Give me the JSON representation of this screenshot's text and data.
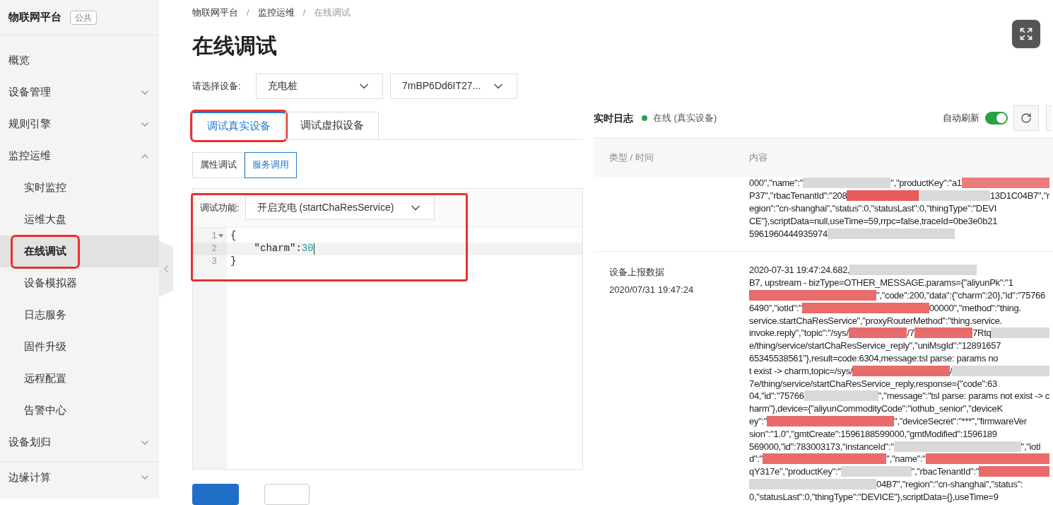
{
  "sidebar": {
    "title": "物联网平台",
    "badge": "公共",
    "items": [
      {
        "label": "概览"
      },
      {
        "label": "设备管理",
        "expanded": false
      },
      {
        "label": "规则引擎",
        "expanded": false
      },
      {
        "label": "监控运维",
        "expanded": true,
        "children": [
          {
            "label": "实时监控",
            "selected": false,
            "annotated": false
          },
          {
            "label": "运维大盘",
            "selected": false,
            "annotated": false
          },
          {
            "label": "在线调试",
            "selected": true,
            "annotated": true
          },
          {
            "label": "设备模拟器",
            "selected": false,
            "annotated": false
          },
          {
            "label": "日志服务",
            "selected": false,
            "annotated": false
          },
          {
            "label": "固件升级",
            "selected": false,
            "annotated": false
          },
          {
            "label": "远程配置",
            "selected": false,
            "annotated": false
          },
          {
            "label": "告警中心",
            "selected": false,
            "annotated": false
          }
        ]
      },
      {
        "label": "设备划归",
        "expanded": false
      },
      {
        "label": "边缘计算",
        "expanded": false
      }
    ]
  },
  "breadcrumb": [
    "物联网平台",
    "监控运维",
    "在线调试"
  ],
  "breadcrumb_separator": "/",
  "page_title": "在线调试",
  "device_select": {
    "label": "请选择设备:",
    "product": "充电桩",
    "device": "7mBP6Dd6IT27..."
  },
  "tabs": [
    {
      "label": "调试真实设备",
      "selected": true,
      "annotated": true
    },
    {
      "label": "调试虚拟设备",
      "selected": false,
      "annotated": false
    }
  ],
  "subtabs": [
    {
      "label": "属性调试",
      "selected": false
    },
    {
      "label": "服务调用",
      "selected": true
    }
  ],
  "function_panel": {
    "annotated": true,
    "label": "调试功能:",
    "value": "开启充电 (startChaResService)",
    "code_lines": [
      {
        "number": "1",
        "foldable": true,
        "active": false,
        "tokens": [
          {
            "kind": "punct",
            "text": "{"
          }
        ]
      },
      {
        "number": "2",
        "foldable": false,
        "active": true,
        "tokens": [
          {
            "kind": "punct",
            "text": "    \"charm\":"
          },
          {
            "kind": "number",
            "text": "30"
          }
        ]
      },
      {
        "number": "3",
        "foldable": false,
        "active": false,
        "tokens": [
          {
            "kind": "punct",
            "text": "}"
          }
        ]
      }
    ]
  },
  "log": {
    "title": "实时日志",
    "status": {
      "text": "在线 (真实设备)",
      "color": "#2e9e4f"
    },
    "auto_refresh": {
      "label": "自动刷新",
      "on": true
    },
    "columns": [
      "类型 / 时间",
      "内容"
    ],
    "records": [
      {
        "lines": [
          [
            {
              "kind": "text",
              "text": "000\",\"name\":\""
            },
            {
              "kind": "redacted",
              "color": "#d9d9d9"
            },
            {
              "kind": "text",
              "text": "\",\"productKey\":\"a1"
            },
            {
              "kind": "redacted",
              "color": "#ec7b7b"
            }
          ],
          [
            {
              "kind": "text",
              "text": "P37\",\"rbacTenantId\":\"208"
            },
            {
              "kind": "redacted",
              "color": "#e85a5a"
            },
            {
              "kind": "redacted",
              "color": "#d9d9d9"
            },
            {
              "kind": "text",
              "text": "13D1C04B7\",\"r"
            }
          ],
          [
            {
              "kind": "text",
              "text": "egion\":\"cn-shanghai\",\"status\":0,\"statusLast\":0,\"thingType\":\"DEVI"
            }
          ],
          [
            {
              "kind": "text",
              "text": "CE\"},scriptData=null,useTime=59,rrpc=false,traceId=0be3e0b21"
            }
          ],
          [
            {
              "kind": "text",
              "text": "5961960444935974"
            },
            {
              "kind": "redacted",
              "color": "#d9d9d9"
            }
          ]
        ]
      },
      {
        "type": "设备上报数据",
        "time": "2020/07/31 19:47:24",
        "lines": [
          [
            {
              "kind": "text",
              "text": "2020-07-31 19:47:24.682, "
            },
            {
              "kind": "redacted",
              "color": "#d9d9d9"
            }
          ],
          [
            {
              "kind": "text",
              "text": "B7, upstream - bizType=OTHER_MESSAGE,params={\"aliyunPk\":\"1"
            }
          ],
          [
            {
              "kind": "redacted",
              "color": "#e96b6b"
            },
            {
              "kind": "text",
              "text": "\",\"code\":200,\"data\":{\"charm\":20},\"id\":\"75766"
            }
          ],
          [
            {
              "kind": "text",
              "text": "6490\",\"iotId\":\""
            },
            {
              "kind": "redacted",
              "color": "#e96b6b"
            },
            {
              "kind": "text",
              "text": "00000\",\"method\":\"thing."
            }
          ],
          [
            {
              "kind": "text",
              "text": "service.startChaResService\",\"proxyRouterMethod\":\"thing.service."
            }
          ],
          [
            {
              "kind": "text",
              "text": "invoke.reply\",\"topic\":\"/sys/"
            },
            {
              "kind": "redacted",
              "color": "#e96b6b"
            },
            {
              "kind": "text",
              "text": "/7"
            },
            {
              "kind": "redacted",
              "color": "#e96b6b"
            },
            {
              "kind": "text",
              "text": "7Rtq"
            },
            {
              "kind": "redacted",
              "color": "#d9d9d9"
            }
          ],
          [
            {
              "kind": "text",
              "text": "e/thing/service/startChaResService_reply\",\"uniMsgId\":\"12891657"
            }
          ],
          [
            {
              "kind": "text",
              "text": "65345538561\"},result=code:6304,message:tsl parse: params no"
            }
          ],
          [
            {
              "kind": "text",
              "text": "t exist -> charm,topic=/sys/"
            },
            {
              "kind": "redacted",
              "color": "#e96b6b"
            },
            {
              "kind": "text",
              "text": "/"
            },
            {
              "kind": "redacted",
              "color": "#d9d9d9"
            }
          ],
          [
            {
              "kind": "text",
              "text": "7e/thing/service/startChaResService_reply,response={\"code\":63"
            }
          ],
          [
            {
              "kind": "text",
              "text": "04,\"id\":\"75766"
            },
            {
              "kind": "redacted",
              "color": "#d9d9d9"
            },
            {
              "kind": "text",
              "text": "\",\"message\":\"tsl parse: params not exist -> c"
            }
          ],
          [
            {
              "kind": "text",
              "text": "harm\"},device={\"aliyunCommodityCode\":\"iothub_senior\",\"deviceK"
            }
          ],
          [
            {
              "kind": "text",
              "text": "ey\":\""
            },
            {
              "kind": "redacted",
              "color": "#e96b6b"
            },
            {
              "kind": "text",
              "text": "\",\"deviceSecret\":\"***\",\"firmwareVer"
            }
          ],
          [
            {
              "kind": "text",
              "text": "sion\":\"1.0\",\"gmtCreate\":1596188599000,\"gmtModified\":1596189"
            }
          ],
          [
            {
              "kind": "text",
              "text": "569000,\"id\":783003173,\"instanceId\":\""
            },
            {
              "kind": "redacted",
              "color": "#d9d9d9"
            },
            {
              "kind": "text",
              "text": "\",\"iotI"
            }
          ],
          [
            {
              "kind": "text",
              "text": "d\":\""
            },
            {
              "kind": "redacted",
              "color": "#e96b6b"
            },
            {
              "kind": "text",
              "text": "\",\"name\":\""
            },
            {
              "kind": "redacted",
              "color": "#e96b6b"
            }
          ],
          [
            {
              "kind": "text",
              "text": "qY317e\",\"productKey\":\""
            },
            {
              "kind": "redacted",
              "color": "#d9d9d9"
            },
            {
              "kind": "text",
              "text": "\",\"rbacTenantId\":\""
            },
            {
              "kind": "redacted",
              "color": "#e96b6b"
            }
          ],
          [
            {
              "kind": "redacted",
              "color": "#d9d9d9"
            },
            {
              "kind": "text",
              "text": "04B7\",\"region\":\"cn-shanghai\",\"status\":"
            }
          ],
          [
            {
              "kind": "text",
              "text": "0,\"statusLast\":0,\"thingType\":\"DEVICE\"},scriptData={},useTime=9"
            }
          ]
        ]
      }
    ]
  }
}
